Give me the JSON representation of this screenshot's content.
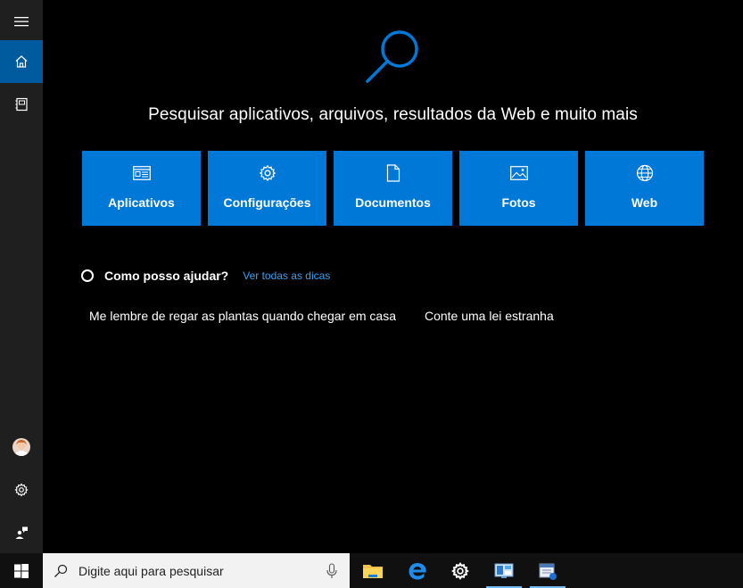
{
  "sidebar": {
    "items": [
      {
        "name": "menu",
        "icon": "hamburger-icon"
      },
      {
        "name": "home",
        "icon": "home-icon",
        "active": true
      },
      {
        "name": "notebook",
        "icon": "notebook-icon"
      },
      {
        "name": "account",
        "icon": "avatar-icon"
      },
      {
        "name": "settings",
        "icon": "gear-icon"
      },
      {
        "name": "feedback",
        "icon": "feedback-icon"
      }
    ]
  },
  "main": {
    "headline": "Pesquisar aplicativos, arquivos, resultados da Web e muito mais",
    "tiles": [
      {
        "label": "Aplicativos",
        "icon": "apps-icon"
      },
      {
        "label": "Configurações",
        "icon": "gear-icon"
      },
      {
        "label": "Documentos",
        "icon": "document-icon"
      },
      {
        "label": "Fotos",
        "icon": "photo-icon"
      },
      {
        "label": "Web",
        "icon": "globe-icon"
      }
    ],
    "help": {
      "title": "Como posso ajudar?",
      "link": "Ver todas as dicas"
    },
    "suggestions": [
      "Me lembre de regar as plantas quando chegar em casa",
      "Conte uma lei estranha"
    ]
  },
  "taskbar": {
    "search_placeholder": "Digite aqui para pesquisar",
    "apps": [
      {
        "name": "File Explorer",
        "icon": "folder-icon"
      },
      {
        "name": "Microsoft Edge",
        "icon": "edge-icon"
      },
      {
        "name": "Configurações",
        "icon": "gear-icon"
      },
      {
        "name": "Control Panel",
        "icon": "control-panel-icon"
      },
      {
        "name": "Mail",
        "icon": "mail-app-icon"
      }
    ]
  },
  "colors": {
    "accent": "#0078d7",
    "active_rail": "#005a9e",
    "link": "#3aa0f3",
    "rail_bg": "#1f1f1f",
    "main_bg": "#000000"
  }
}
